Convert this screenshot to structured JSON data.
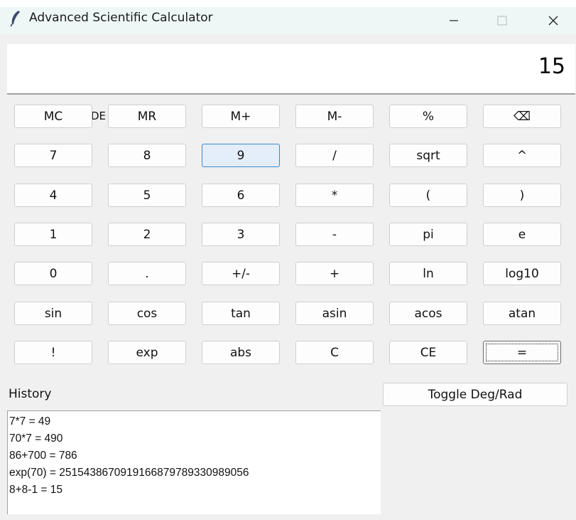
{
  "window": {
    "title": "Advanced Scientific Calculator",
    "icon": "feather-icon",
    "controls": [
      "minimize-icon",
      "maximize-icon",
      "close-icon"
    ]
  },
  "display": {
    "value": "15"
  },
  "mode_label_partial": "DEG",
  "buttons": [
    [
      "MC",
      "MR",
      "M+",
      "M-",
      "%",
      "⌫"
    ],
    [
      "7",
      "8",
      "9",
      "/",
      "sqrt",
      "^"
    ],
    [
      "4",
      "5",
      "6",
      "*",
      "(",
      ")"
    ],
    [
      "1",
      "2",
      "3",
      "-",
      "pi",
      "e"
    ],
    [
      "0",
      ".",
      "+/-",
      "+",
      "ln",
      "log10"
    ],
    [
      "sin",
      "cos",
      "tan",
      "asin",
      "acos",
      "atan"
    ],
    [
      "!",
      "exp",
      "abs",
      "C",
      "CE",
      "="
    ]
  ],
  "hovered_button": "9",
  "focused_button": "=",
  "history": {
    "label": "History",
    "entries": [
      "7*7 = 49",
      "70*7 = 490",
      "86+700 = 786",
      "exp(70) = 2515438670919166879789330989056",
      "8+8-1 = 15"
    ]
  },
  "toggle_label": "Toggle Deg/Rad"
}
